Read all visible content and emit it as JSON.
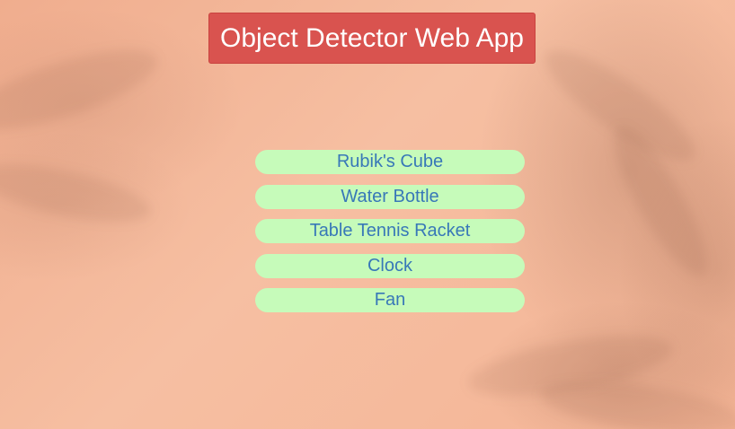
{
  "header": {
    "title": "Object Detector Web App"
  },
  "objects": {
    "items": [
      {
        "label": "Rubik's Cube"
      },
      {
        "label": "Water Bottle"
      },
      {
        "label": "Table Tennis Racket"
      },
      {
        "label": "Clock"
      },
      {
        "label": "Fan"
      }
    ]
  },
  "colors": {
    "background": "#f5b899",
    "title_button": "#d9534f",
    "item_background": "#c6fbba",
    "item_text": "#3878b8"
  }
}
